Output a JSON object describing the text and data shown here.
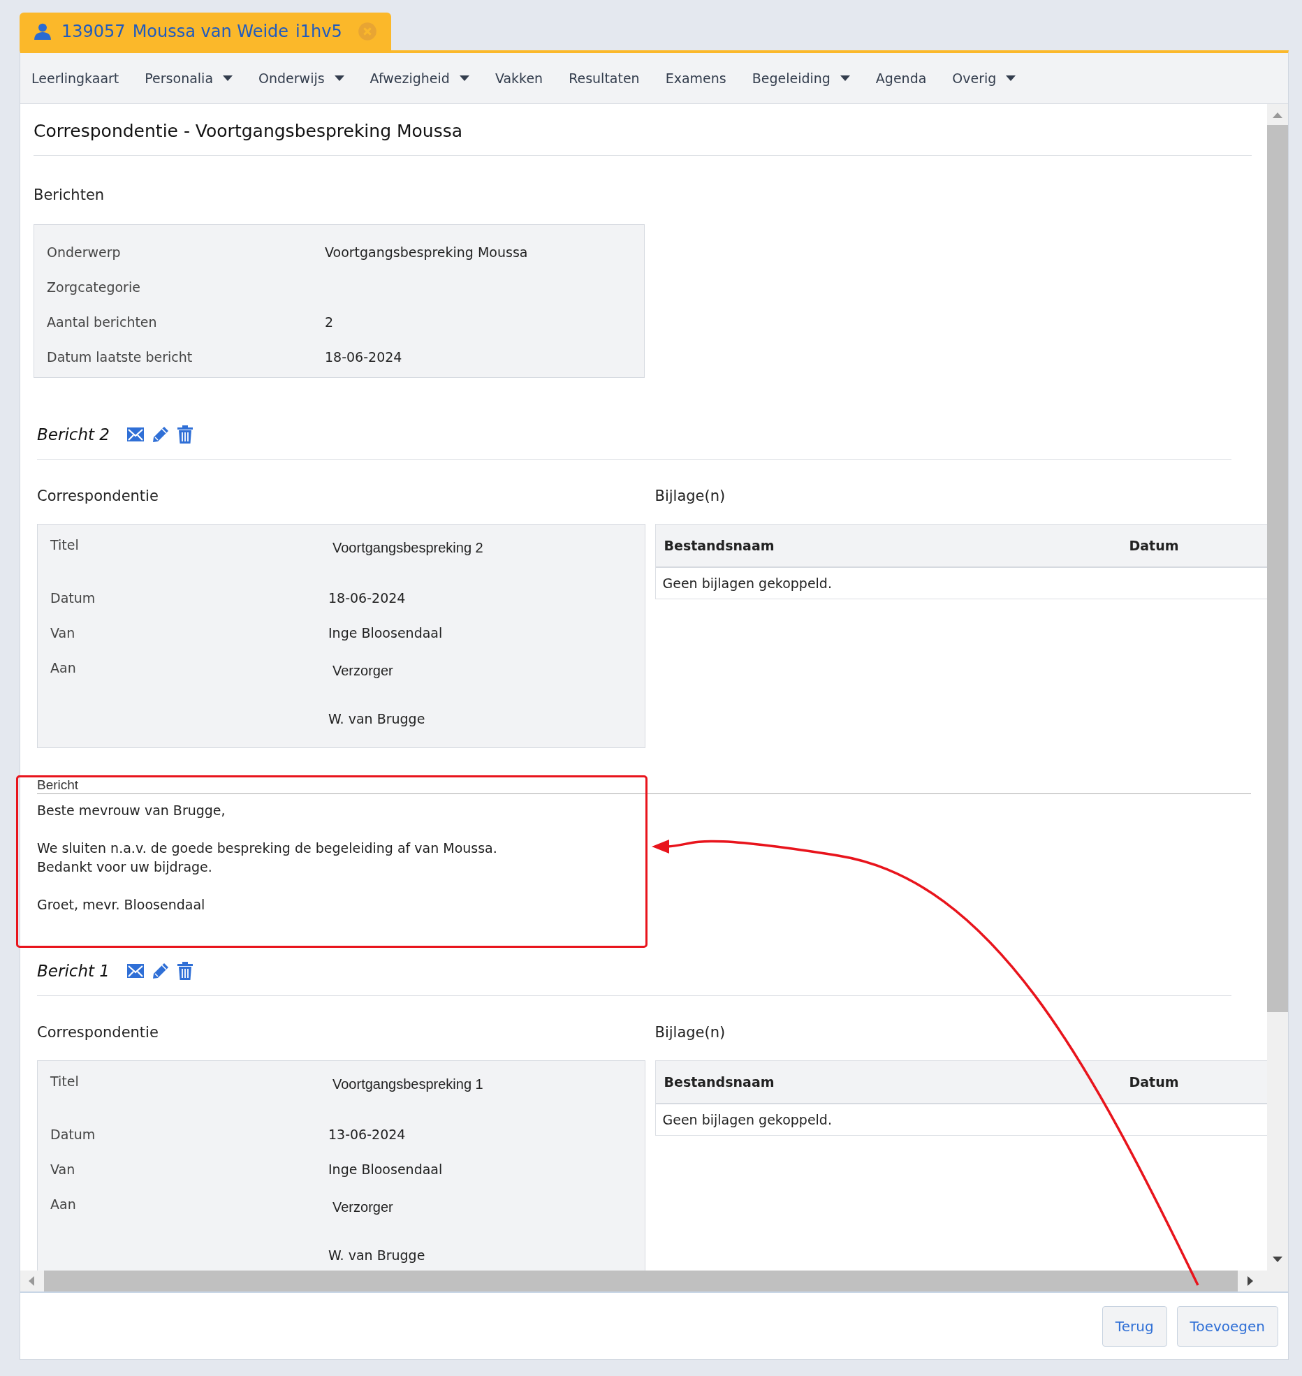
{
  "student_tab": {
    "number": "139057",
    "name": "Moussa van Weide",
    "class": "i1hv5"
  },
  "nav": [
    {
      "label": "Leerlingkaart",
      "dropdown": false
    },
    {
      "label": "Personalia",
      "dropdown": true
    },
    {
      "label": "Onderwijs",
      "dropdown": true
    },
    {
      "label": "Afwezigheid",
      "dropdown": true
    },
    {
      "label": "Vakken",
      "dropdown": false
    },
    {
      "label": "Resultaten",
      "dropdown": false
    },
    {
      "label": "Examens",
      "dropdown": false
    },
    {
      "label": "Begeleiding",
      "dropdown": true
    },
    {
      "label": "Agenda",
      "dropdown": false
    },
    {
      "label": "Overig",
      "dropdown": true
    }
  ],
  "title": "Correspondentie - Voortgangsbespreking Moussa",
  "summary": {
    "heading": "Berichten",
    "rows": [
      {
        "label": "Onderwerp",
        "value": "Voortgangsbespreking Moussa"
      },
      {
        "label": "Zorgcategorie",
        "value": ""
      },
      {
        "label": "Aantal berichten",
        "value": "2"
      },
      {
        "label": "Datum laatste bericht",
        "value": "18-06-2024"
      }
    ]
  },
  "messages": [
    {
      "heading": "Bericht 2",
      "correspondence_heading": "Correspondentie",
      "attachments_heading": "Bijlage(n)",
      "fields": [
        {
          "label": "Titel",
          "values": [
            "Voortgangsbespreking 2"
          ]
        },
        {
          "label": "Datum",
          "values": [
            "18-06-2024"
          ]
        },
        {
          "label": "Van",
          "values": [
            "Inge Bloosendaal"
          ]
        },
        {
          "label": "Aan",
          "values": [
            "Verzorger",
            "W. van Brugge"
          ]
        }
      ],
      "attachments": {
        "columns": [
          "Bestandsnaam",
          "Datum"
        ],
        "empty": "Geen bijlagen gekoppeld."
      },
      "body": {
        "label": "Bericht",
        "paragraphs": [
          [
            "Beste mevrouw van Brugge,"
          ],
          [
            "We sluiten n.a.v. de goede bespreking de begeleiding af van Moussa.",
            "Bedankt voor uw bijdrage."
          ],
          [
            "Groet, mevr. Bloosendaal"
          ]
        ]
      }
    },
    {
      "heading": "Bericht 1",
      "correspondence_heading": "Correspondentie",
      "attachments_heading": "Bijlage(n)",
      "fields": [
        {
          "label": "Titel",
          "values": [
            "Voortgangsbespreking 1"
          ]
        },
        {
          "label": "Datum",
          "values": [
            "13-06-2024"
          ]
        },
        {
          "label": "Van",
          "values": [
            "Inge Bloosendaal"
          ]
        },
        {
          "label": "Aan",
          "values": [
            "Verzorger",
            "W. van Brugge"
          ]
        }
      ],
      "attachments": {
        "columns": [
          "Bestandsnaam",
          "Datum"
        ],
        "empty": "Geen bijlagen gekoppeld."
      }
    }
  ],
  "buttons": [
    "Terug",
    "Toevoegen"
  ]
}
